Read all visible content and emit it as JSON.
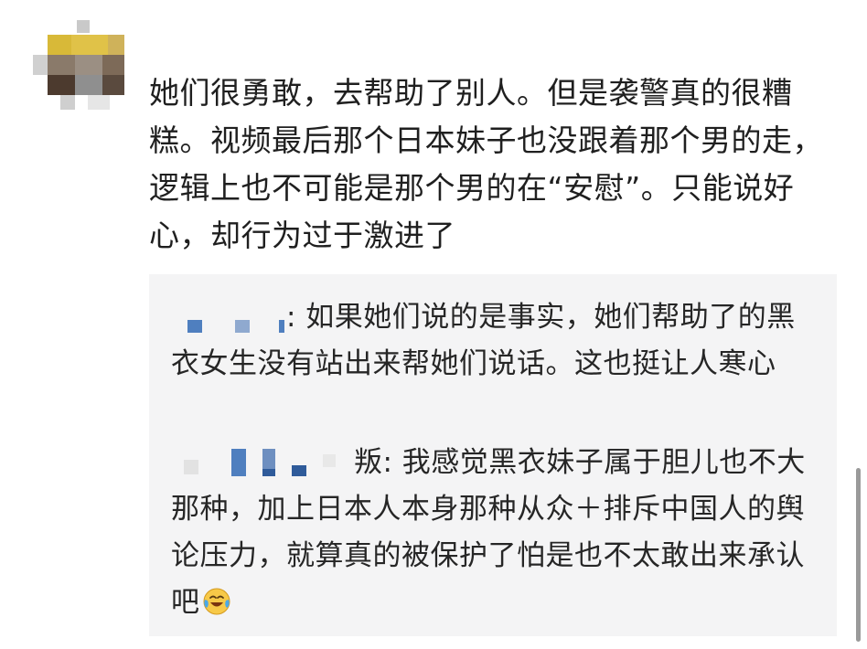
{
  "comment": {
    "text": "她们很勇敢，去帮助了别人。但是袭警真的很糟糕。视频最后那个日本妹子也没跟着那个男的走，逻辑上也不可能是那个男的在“安慰”。只能说好心，却行为过于激进了"
  },
  "replies": [
    {
      "username_suffix": ":",
      "text": " 如果她们说的是事实，她们帮助了的黑衣女生没有站出来帮她们说话。这也挺让人寒心"
    },
    {
      "username_suffix": "叛:",
      "text": " 我感觉黑衣妹子属于胆儿也不大那种，加上日本人本身那种从众＋排斥中国人的舆论压力，就算真的被保护了怕是也不太敢出来承认吧",
      "emoji": "laughing-crying-emoji"
    }
  ],
  "colors": {
    "reply_background": "#f4f4f5",
    "mosaic_blue": "#4f7fbf",
    "text": "#1f1f1f"
  }
}
